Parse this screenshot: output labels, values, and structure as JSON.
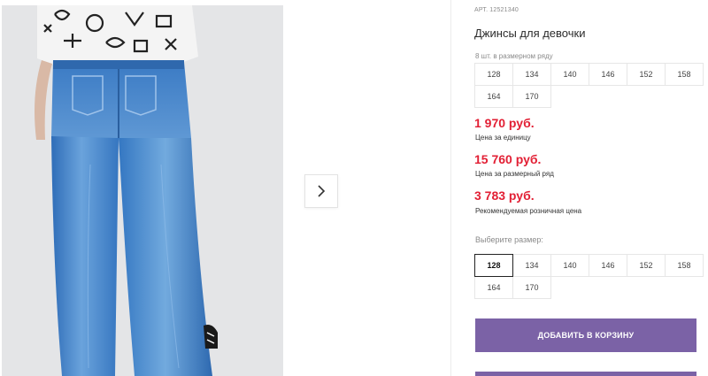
{
  "product": {
    "article_prefix": "АРТ.",
    "article_number": "12521340",
    "title": "Джинсы для девочки"
  },
  "size_row": {
    "label": "8 шт. в размерном ряду",
    "sizes": [
      "128",
      "134",
      "140",
      "146",
      "152",
      "158",
      "164",
      "170"
    ]
  },
  "prices": {
    "unit_price": "1 970 руб.",
    "unit_note": "Цена за единицу",
    "row_price": "15 760 руб.",
    "row_note": "Цена за размерный ряд",
    "retail_price": "3 783 руб.",
    "retail_note": "Рекомендуемая розничная цена"
  },
  "size_selector": {
    "label": "Выберите размер:",
    "selected": "128",
    "sizes": [
      "128",
      "134",
      "140",
      "146",
      "152",
      "158",
      "164",
      "170"
    ]
  },
  "actions": {
    "add_to_cart": "ДОБАВИТЬ В КОРЗИНУ"
  },
  "gallery": {
    "next_icon": "chevron-right-icon"
  },
  "colors": {
    "price_red": "#e21f34",
    "button_purple": "#7b62a6",
    "denim_blue": "#3f7fc8"
  }
}
